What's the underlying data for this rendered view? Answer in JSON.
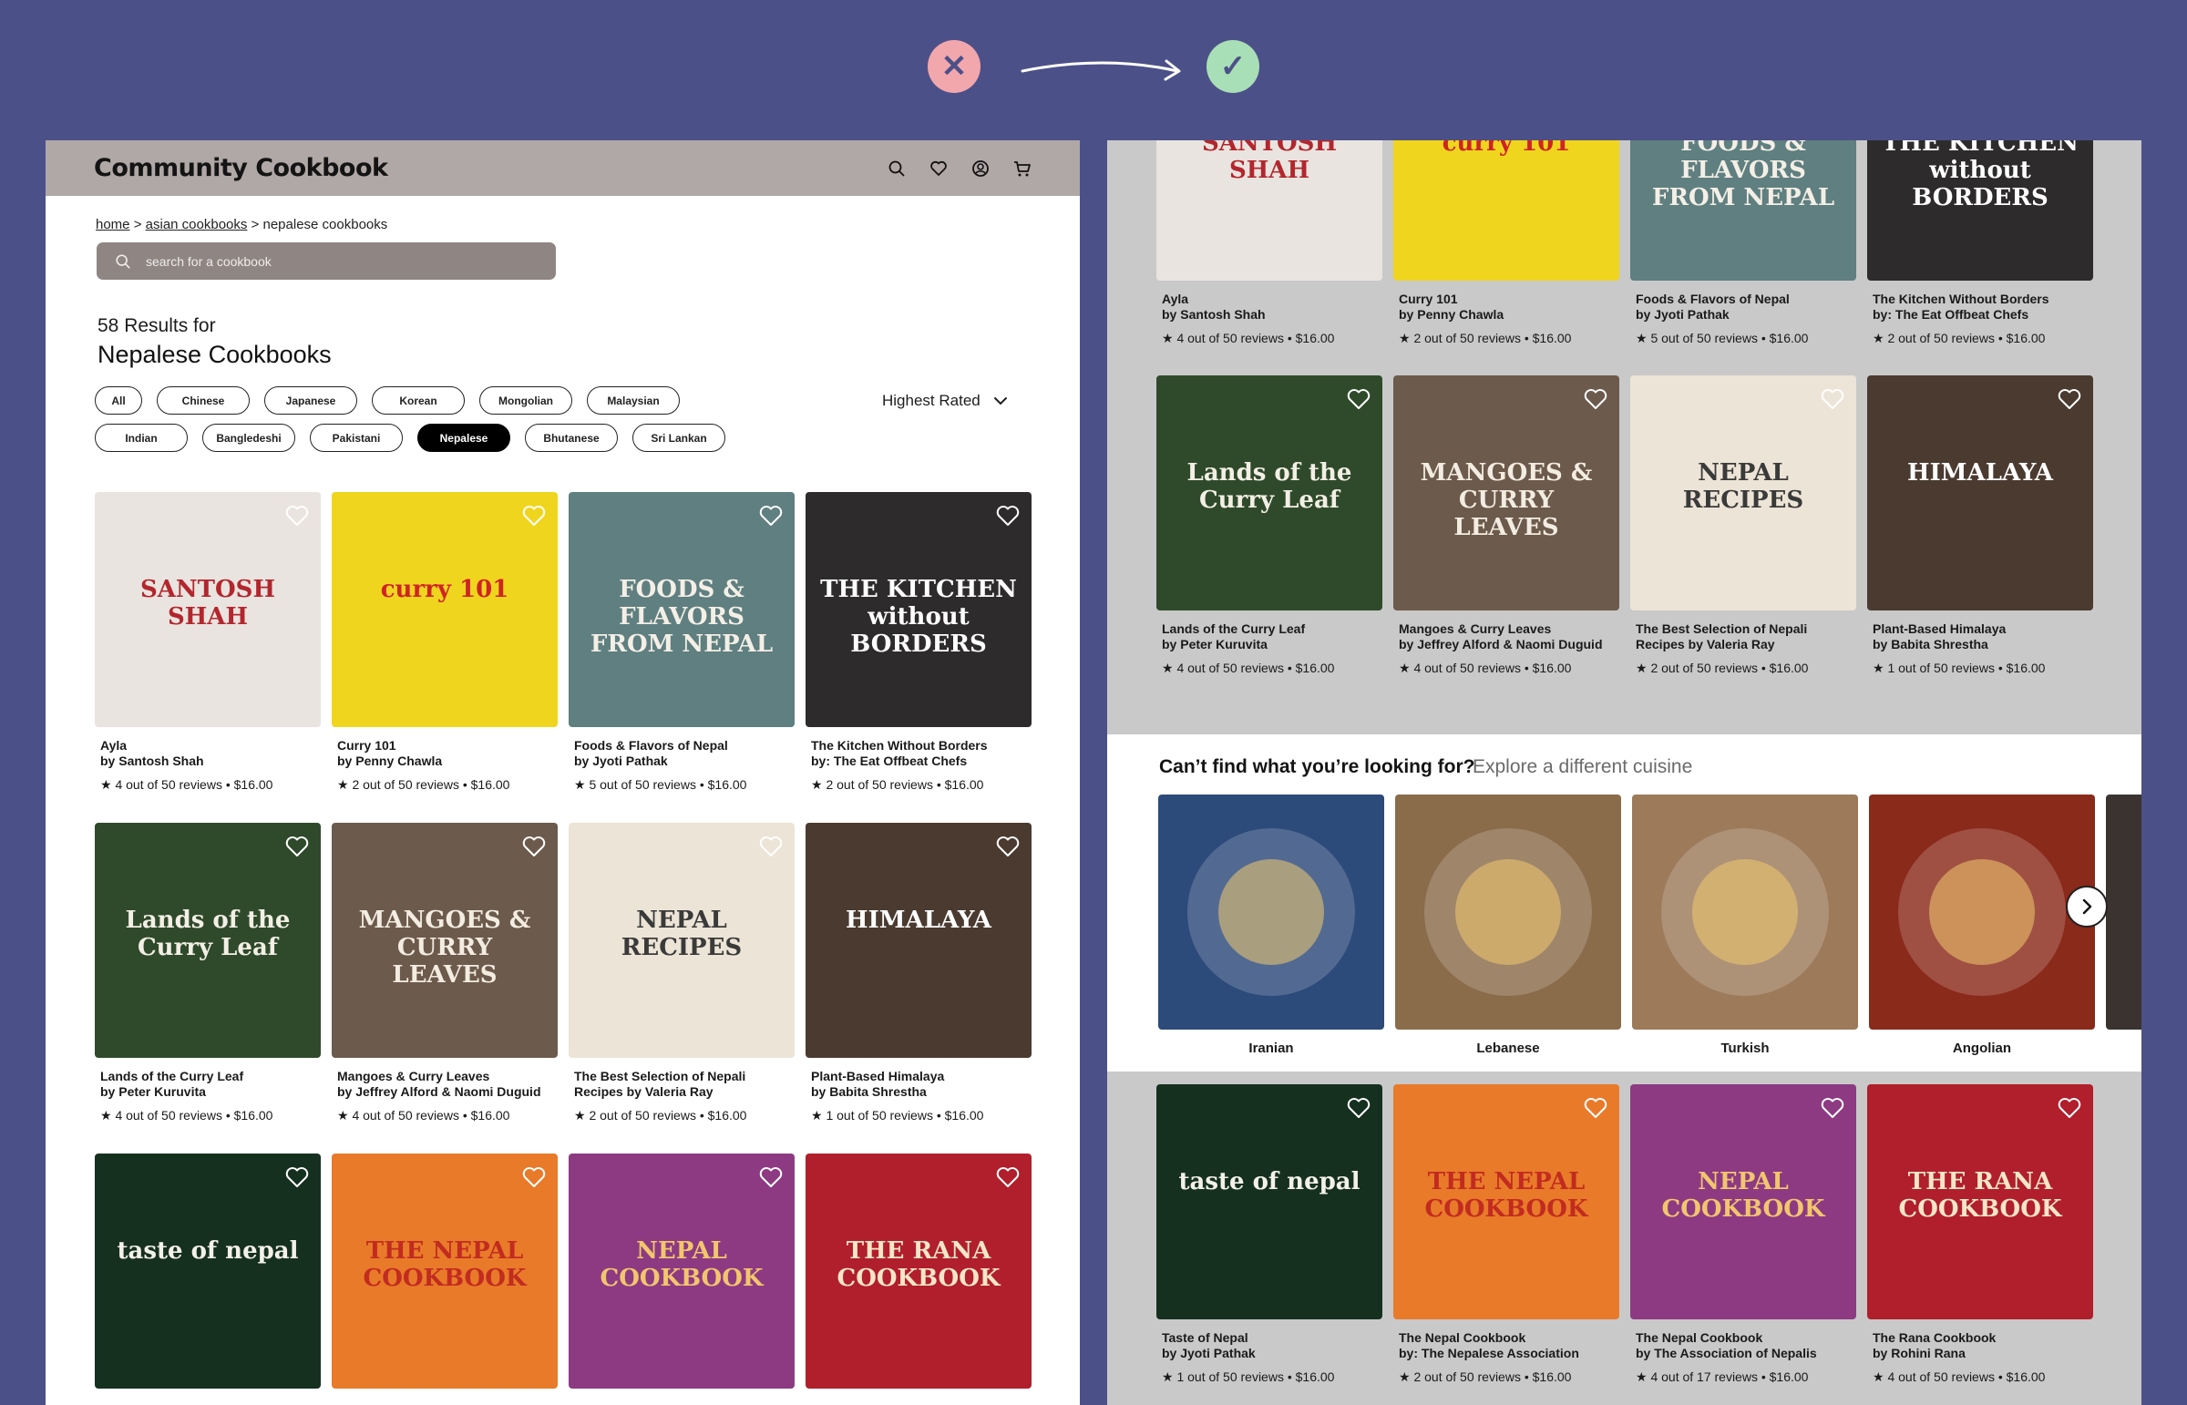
{
  "colors": {
    "background": "#4c5088",
    "header": "#b0a8a6",
    "search_bg": "#8f8684",
    "active_chip": "#000000",
    "bad": "#f2a7ad",
    "good": "#a9dfb6"
  },
  "indicator": {
    "bad_glyph": "✕",
    "good_glyph": "✓"
  },
  "left": {
    "brand": "Community Cookbook",
    "icons": [
      "search-icon",
      "heart-icon",
      "user-icon",
      "cart-icon"
    ],
    "breadcrumb": {
      "home": "home",
      "sep1": " > ",
      "asian": "asian cookbooks",
      "sep2": " > ",
      "current": "nepalese cookbooks"
    },
    "search_placeholder": "search for a cookbook",
    "results_count": "58 Results for",
    "results_title": "Nepalese Cookbooks",
    "sort_label": "Highest Rated",
    "chips_row1": [
      "All",
      "Chinese",
      "Japanese",
      "Korean",
      "Mongolian",
      "Malaysian"
    ],
    "chips_row2": [
      "Indian",
      "Bangledeshi",
      "Pakistani",
      "Nepalese",
      "Bhutanese",
      "Sri Lankan"
    ],
    "active_chip": "Nepalese",
    "books": [
      {
        "title1": "Ayla",
        "title2": "by Santosh Shah",
        "meta": "★ 4 out of 50 reviews  •  $16.00",
        "cover_text": "SANTOSH SHAH",
        "cover_bg": "#e9e4df",
        "cover_fg": "#b3262d"
      },
      {
        "title1": "Curry 101",
        "title2": "by Penny Chawla",
        "meta": "★ 2 out of 50 reviews  •  $16.00",
        "cover_text": "curry 101",
        "cover_bg": "#f0d51e",
        "cover_fg": "#cf2424"
      },
      {
        "title1": "Foods & Flavors of Nepal",
        "title2": "by Jyoti Pathak",
        "meta": "★ 5 out of 50 reviews  •  $16.00",
        "cover_text": "FOODS & FLAVORS FROM NEPAL",
        "cover_bg": "#5f7f80",
        "cover_fg": "#f4efe6"
      },
      {
        "title1": "The Kitchen Without Borders",
        "title2": "by: The Eat Offbeat Chefs",
        "meta": "★ 2 out of 50 reviews  •  $16.00",
        "cover_text": "THE KITCHEN without BORDERS",
        "cover_bg": "#2d2b2b",
        "cover_fg": "#ffffff"
      },
      {
        "title1": "Lands of the Curry Leaf",
        "title2": "by Peter Kuruvita",
        "meta": "★ 4 out of 50 reviews  •  $16.00",
        "cover_text": "Lands of the Curry Leaf",
        "cover_bg": "#2f4a2b",
        "cover_fg": "#f3efe5"
      },
      {
        "title1": "Mangoes & Curry Leaves",
        "title2": "by Jeffrey Alford & Naomi Duguid",
        "meta": "★ 4 out of 50 reviews  •  $16.00",
        "cover_text": "MANGOES & CURRY LEAVES",
        "cover_bg": "#6c5a4c",
        "cover_fg": "#f3ece0"
      },
      {
        "title1": "The Best Selection of Nepali",
        "title2": "Recipes by Valeria Ray",
        "meta": "★ 2 out of 50 reviews  •  $16.00",
        "cover_text": "NEPAL RECIPES",
        "cover_bg": "#ece4d6",
        "cover_fg": "#3a3a3a"
      },
      {
        "title1": "Plant-Based Himalaya",
        "title2": "by Babita Shrestha",
        "meta": "★ 1 out of 50 reviews  •  $16.00",
        "cover_text": "HIMALAYA",
        "cover_bg": "#4a3a30",
        "cover_fg": "#ffffff"
      },
      {
        "title1": "Taste of Nepal",
        "title2": "by Jyoti Pathak",
        "meta": "★ 1 out of 50 reviews  •  $16.00",
        "cover_text": "taste of nepal",
        "cover_bg": "#16301f",
        "cover_fg": "#f3f1e8"
      },
      {
        "title1": "The Nepal Cookbook",
        "title2": "by: The Nepalese Association",
        "meta": "★ 2 out of 50 reviews  •  $16.00",
        "cover_text": "THE NEPAL COOKBOOK",
        "cover_bg": "#e97a2a",
        "cover_fg": "#c22b20"
      },
      {
        "title1": "The Nepal Cookbook",
        "title2": "by The Association of Nepalis",
        "meta": "★ 4 out of 17 reviews  •  $16.00",
        "cover_text": "NEPAL COOKBOOK",
        "cover_bg": "#8d3a83",
        "cover_fg": "#f2c66d"
      },
      {
        "title1": "The Rana Cookbook",
        "title2": "by Rohini Rana",
        "meta": "★ 4 out of 50 reviews  •  $16.00",
        "cover_text": "THE RANA COOKBOOK",
        "cover_bg": "#b01f2b",
        "cover_fg": "#f6e6c8"
      }
    ]
  },
  "right": {
    "explore_question": "Can’t find what you’re looking for?",
    "explore_link": "Explore a different cuisine",
    "cuisines": [
      {
        "label": "Iranian",
        "bg": "#2c4a7a"
      },
      {
        "label": "Lebanese",
        "bg": "#8a6b4a"
      },
      {
        "label": "Turkish",
        "bg": "#9c7a5a"
      },
      {
        "label": "Angolian",
        "bg": "#8a2a1a"
      }
    ],
    "books_top": [
      0,
      1,
      2,
      3,
      4,
      5,
      6,
      7
    ],
    "books_bottom": [
      8,
      9,
      10,
      11
    ]
  }
}
